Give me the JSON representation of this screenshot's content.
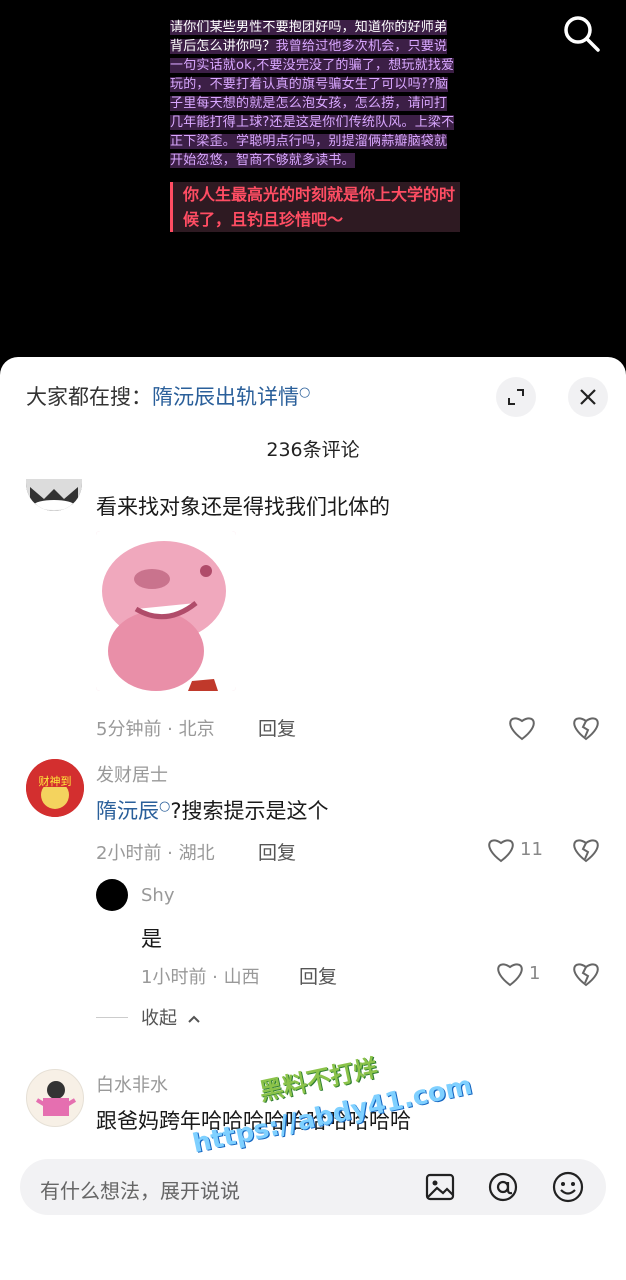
{
  "video": {
    "text_white_1": "请你们某些男性不要抱团好吗，知道你的好师弟背后怎么讲你吗？",
    "text_purple": "我曾给过他多次机会，只要说一句实话就ok,不要没完没了的骗了，想玩就找爱玩的，不要打着认真的旗号骗女生了可以吗??脑子里每天想的就是怎么泡女孩，怎么捞，请问打几年能打得上球?还是这是你们传统队风。上梁不正下梁歪。学聪明点行吗，别提溜俩蒜瓣脑袋就开始忽悠，智商不够就多读书。",
    "text_red": "你人生最高光的时刻就是你上大学的时候了，且钓且珍惜吧～"
  },
  "header": {
    "hot_search_prefix": "大家都在搜：",
    "hot_search_term": "隋沅辰出轨详情",
    "comment_count": "236条评论"
  },
  "comments": [
    {
      "text": "看来找对象还是得找我们北体的",
      "time_location": "5分钟前 · 北京",
      "reply_label": "回复"
    },
    {
      "username": "发财居士",
      "text_link": "隋沅辰",
      "text_rest": "?搜索提示是这个",
      "time_location": "2小时前 · 湖北",
      "reply_label": "回复",
      "likes": "11",
      "avatar_text": "财神到"
    },
    {
      "username": "Shy",
      "text": "是",
      "time_location": "1小时前 · 山西",
      "reply_label": "回复",
      "likes": "1"
    },
    {
      "username": "白水非水",
      "text": "跟爸妈跨年哈哈哈哈哈哈哈哈哈哈"
    }
  ],
  "collapse_label": "收起",
  "input": {
    "placeholder": "有什么想法，展开说说"
  },
  "watermark": {
    "line1": "黑料不打烊",
    "line2": "https://abdy41.com"
  },
  "colors": {
    "link": "#2a5f9a",
    "sheet_bg": "#ffffff",
    "video_red": "#ff4d63",
    "video_purple": "#d9a7ff"
  }
}
